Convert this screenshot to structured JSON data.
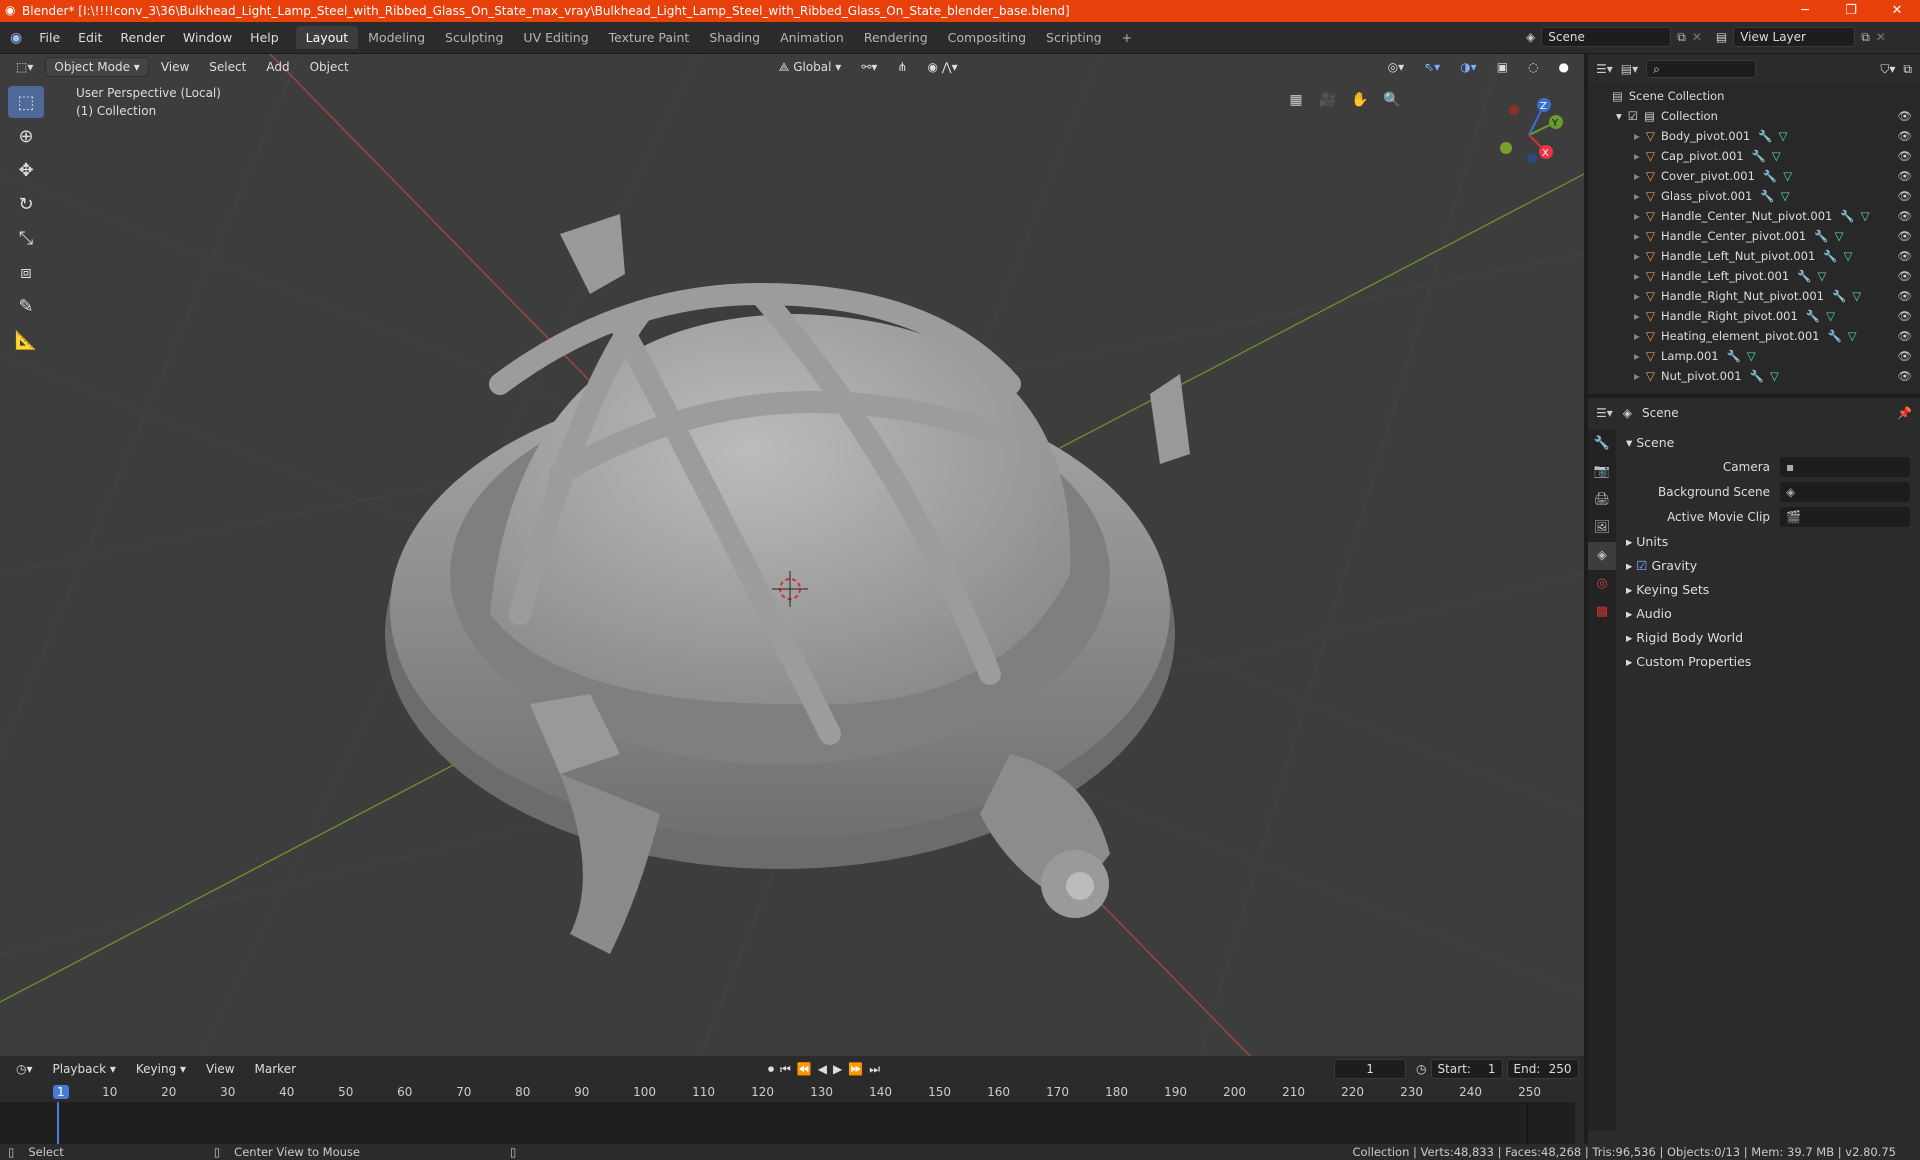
{
  "window": {
    "title": "Blender* [I:\\!!!!conv_3\\36\\Bulkhead_Light_Lamp_Steel_with_Ribbed_Glass_On_State_max_vray\\Bulkhead_Light_Lamp_Steel_with_Ribbed_Glass_On_State_blender_base.blend]"
  },
  "menu": [
    "File",
    "Edit",
    "Render",
    "Window",
    "Help"
  ],
  "workspaces": [
    "Layout",
    "Modeling",
    "Sculpting",
    "UV Editing",
    "Texture Paint",
    "Shading",
    "Animation",
    "Rendering",
    "Compositing",
    "Scripting"
  ],
  "scene_field": "Scene",
  "view_layer_field": "View Layer",
  "viewport": {
    "mode": "Object Mode",
    "menus": [
      "View",
      "Select",
      "Add",
      "Object"
    ],
    "orientation": "Global",
    "perspective_label": "User Perspective (Local)",
    "collection_label": "(1) Collection",
    "gizmo": {
      "x": "X",
      "y": "Y",
      "z": "Z"
    }
  },
  "outliner": {
    "root": "Scene Collection",
    "collection": "Collection",
    "items": [
      "Body_pivot.001",
      "Cap_pivot.001",
      "Cover_pivot.001",
      "Glass_pivot.001",
      "Handle_Center_Nut_pivot.001",
      "Handle_Center_pivot.001",
      "Handle_Left_Nut_pivot.001",
      "Handle_Left_pivot.001",
      "Handle_Right_Nut_pivot.001",
      "Handle_Right_pivot.001",
      "Heating_element_pivot.001",
      "Lamp.001",
      "Nut_pivot.001"
    ]
  },
  "properties": {
    "context": "Scene",
    "section": "Scene",
    "rows": [
      {
        "label": "Camera"
      },
      {
        "label": "Background Scene"
      },
      {
        "label": "Active Movie Clip"
      }
    ],
    "panels": [
      "Units",
      "Gravity",
      "Keying Sets",
      "Audio",
      "Rigid Body World",
      "Custom Properties"
    ]
  },
  "timeline": {
    "menus": [
      "Playback",
      "Keying",
      "View",
      "Marker"
    ],
    "current_frame": "1",
    "start_label": "Start:",
    "start": "1",
    "end_label": "End:",
    "end": "250",
    "ruler": [
      "1",
      "10",
      "20",
      "30",
      "40",
      "50",
      "60",
      "70",
      "80",
      "90",
      "100",
      "110",
      "120",
      "130",
      "140",
      "150",
      "160",
      "170",
      "180",
      "190",
      "200",
      "210",
      "220",
      "230",
      "240",
      "250"
    ]
  },
  "status": {
    "left": "Select",
    "middle": "Center View to Mouse",
    "right": "Collection | Verts:48,833 | Faces:48,268 | Tris:96,536 | Objects:0/13 | Mem: 39.7 MB | v2.80.75"
  }
}
